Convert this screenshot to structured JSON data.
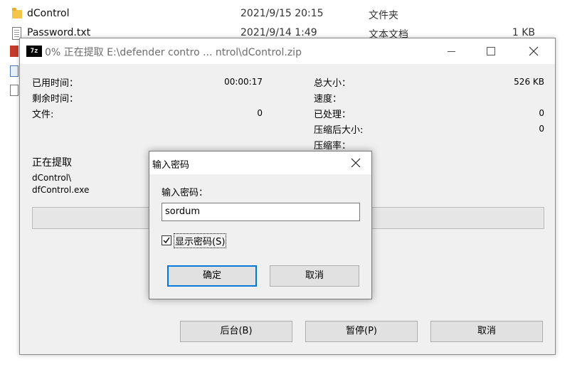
{
  "explorer": {
    "rows": [
      {
        "name": "dControl",
        "date": "2021/9/15 20:15",
        "type": "文件夹",
        "size": ""
      },
      {
        "name": "Password.txt",
        "date": "2021/9/14 1:49",
        "type": "文本文档",
        "size": "1 KB"
      }
    ]
  },
  "zip_window": {
    "logo": "7z",
    "title": "0% 正在提取 E:\\defender contro ... ntrol\\dControl.zip",
    "left_info": [
      {
        "label": "已用时间：",
        "value": "00:00:17"
      },
      {
        "label": "剩余时间：",
        "value": ""
      },
      {
        "label": "文件:",
        "value": "0"
      }
    ],
    "right_info": [
      {
        "label": "总大小：",
        "value": "526 KB"
      },
      {
        "label": "速度：",
        "value": ""
      },
      {
        "label": "已处理：",
        "value": "0"
      },
      {
        "label": "压缩后大小:",
        "value": "0"
      },
      {
        "label": "压缩率：",
        "value": ""
      }
    ],
    "extracting_label": "正在提取",
    "current_path": "dControl\\",
    "current_file": "dfControl.exe",
    "progress": 0,
    "buttons": {
      "background": "后台(B)",
      "pause": "暂停(P)",
      "cancel": "取消"
    }
  },
  "password_dialog": {
    "title": "输入密码",
    "field_label": "输入密码：",
    "value": "sordum",
    "show_password_label": "显示密码(S)",
    "show_password_checked": true,
    "ok": "确定",
    "cancel": "取消"
  }
}
